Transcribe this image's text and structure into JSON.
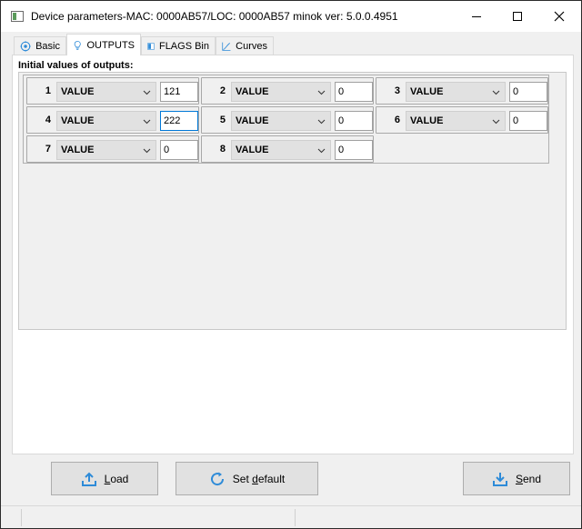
{
  "window": {
    "title": "Device parameters-MAC: 0000AB57/LOC: 0000AB57 minok ver: 5.0.0.4951"
  },
  "tabs": [
    {
      "label": "Basic",
      "icon": "gear-icon"
    },
    {
      "label": "OUTPUTS",
      "icon": "lightbulb-icon"
    },
    {
      "label": "FLAGS Bin",
      "icon": "flags-icon"
    },
    {
      "label": "Curves",
      "icon": "curve-icon"
    }
  ],
  "active_tab": "OUTPUTS",
  "group": {
    "title": "Initial values of outputs:"
  },
  "outputs": [
    {
      "num": "1",
      "mode": "VALUE",
      "value": "121"
    },
    {
      "num": "2",
      "mode": "VALUE",
      "value": "0"
    },
    {
      "num": "3",
      "mode": "VALUE",
      "value": "0"
    },
    {
      "num": "4",
      "mode": "VALUE",
      "value": "222"
    },
    {
      "num": "5",
      "mode": "VALUE",
      "value": "0"
    },
    {
      "num": "6",
      "mode": "VALUE",
      "value": "0"
    },
    {
      "num": "7",
      "mode": "VALUE",
      "value": "0"
    },
    {
      "num": "8",
      "mode": "VALUE",
      "value": "0"
    }
  ],
  "buttons": {
    "load": {
      "label": "Load",
      "underline": "L",
      "rest": "oad",
      "icon": "upload-icon"
    },
    "set_default": {
      "label": "Set default",
      "pre": "Set ",
      "underline": "d",
      "rest": "efault",
      "icon": "refresh-icon"
    },
    "send": {
      "label": "Send",
      "underline": "S",
      "rest": "end",
      "icon": "download-icon"
    }
  },
  "colors": {
    "accent": "#0078d7",
    "icon_blue": "#2e8bd8"
  }
}
